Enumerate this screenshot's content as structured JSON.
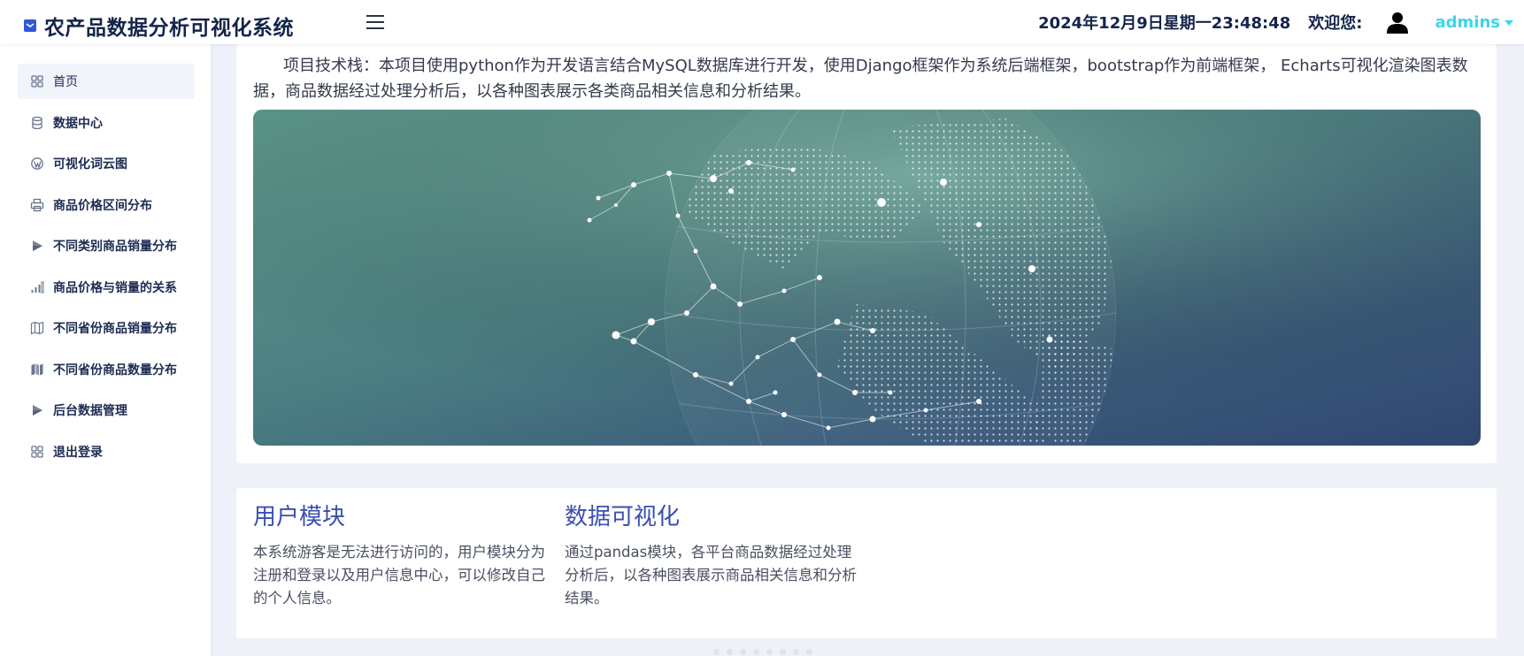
{
  "header": {
    "title": "农产品数据分析可视化系统",
    "datetime": "2024年12月9日星期一23:48:48",
    "welcome": "欢迎您:",
    "username": "admins"
  },
  "sidebar": {
    "items": [
      {
        "label": "首页",
        "icon": "grid-icon"
      },
      {
        "label": "数据中心",
        "icon": "database-icon"
      },
      {
        "label": "可视化词云图",
        "icon": "wordpress-icon"
      },
      {
        "label": "商品价格区间分布",
        "icon": "printer-icon"
      },
      {
        "label": "不同类别商品销量分布",
        "icon": "play-icon"
      },
      {
        "label": "商品价格与销量的关系",
        "icon": "bar-chart-icon"
      },
      {
        "label": "不同省份商品销量分布",
        "icon": "map-icon"
      },
      {
        "label": "不同省份商品数量分布",
        "icon": "map-filled-icon"
      },
      {
        "label": "后台数据管理",
        "icon": "play-icon"
      },
      {
        "label": "退出登录",
        "icon": "grid-icon"
      }
    ]
  },
  "main": {
    "intro": "项目技术栈：本项目使用python作为开发语言结合MySQL数据库进行开发，使用Django框架作为系统后端框架，bootstrap作为前端框架， Echarts可视化渲染图表数据，商品数据经过处理分析后，以各种图表展示各类商品相关信息和分析结果。",
    "modules": [
      {
        "title": "用户模块",
        "desc": "本系统游客是无法进行访问的，用户模块分为注册和登录以及用户信息中心，可以修改自己的个人信息。"
      },
      {
        "title": "数据可视化",
        "desc": "通过pandas模块，各平台商品数据经过处理分析后，以各种图表展示商品相关信息和分析结果。"
      }
    ]
  },
  "colors": {
    "brand_text": "#14244a",
    "username": "#3fd4e8",
    "module_title": "#3b4fb0",
    "background": "#eef1f8"
  }
}
